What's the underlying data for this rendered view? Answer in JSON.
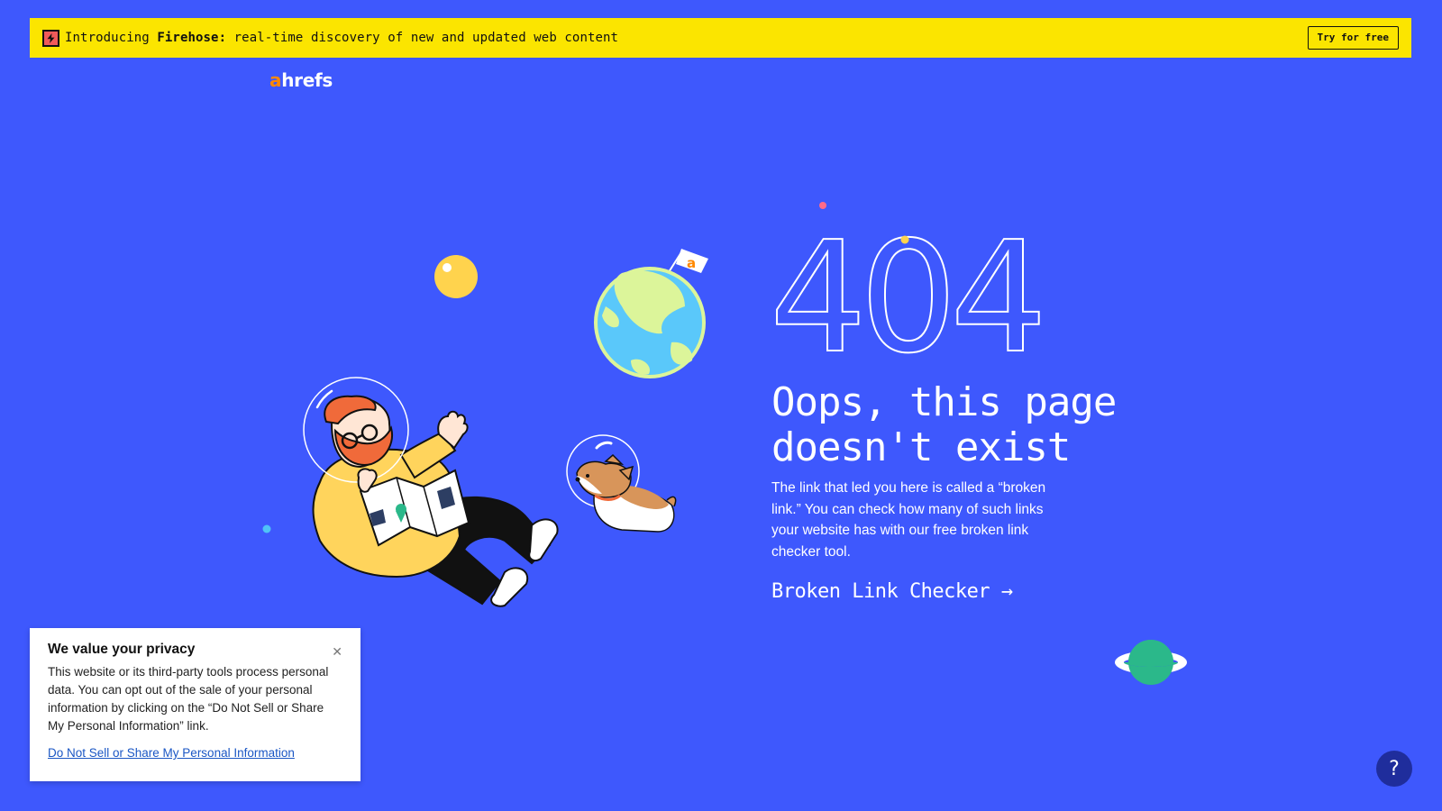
{
  "banner": {
    "prefix": "Introducing ",
    "brand": "Firehose:",
    "message": " real-time discovery of new and updated web content",
    "button_label": "Try for free",
    "icon": "lightning-bolt-icon"
  },
  "logo": {
    "a": "a",
    "rest": "hrefs"
  },
  "error": {
    "code": "404",
    "heading": "Oops, this page doesn't exist",
    "description": "The link that led you here is called a “broken link.” You can check how many of such links your website has with our free broken link checker tool.",
    "link_label": "Broken Link Checker →"
  },
  "privacy": {
    "title": "We value your privacy",
    "body": "This website or its third-party tools process personal data. You can opt out of the sale of your personal information by clicking on the “Do Not Sell or Share My Personal Information” link.",
    "link_label": "Do Not Sell or Share My Personal Information",
    "close_icon": "close-icon"
  },
  "help": {
    "label": "?"
  },
  "flag": {
    "letter": "a"
  },
  "colors": {
    "background": "#3e58fd",
    "banner": "#fbe500",
    "brand_orange": "#ff8800",
    "help_button": "#1f2d9c"
  }
}
